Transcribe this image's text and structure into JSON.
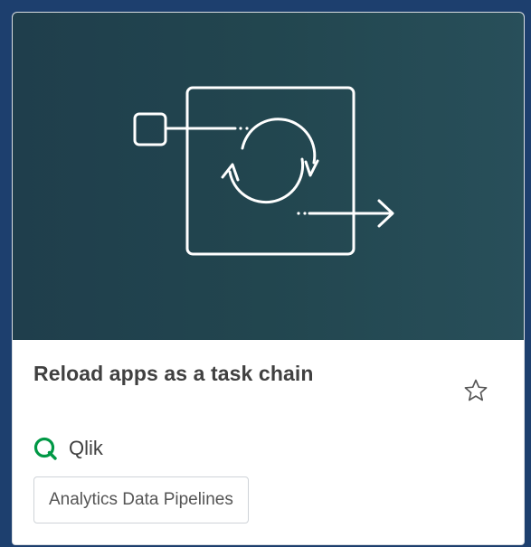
{
  "card": {
    "title": "Reload apps as a task chain",
    "provider": {
      "name": "Qlik",
      "logo_icon": "qlik-q-logo-icon",
      "logo_color": "#009845"
    },
    "tag": "Analytics Data Pipelines",
    "favorite_icon": "star-outline-icon",
    "hero_illustration": "task-chain-reload-icon"
  },
  "colors": {
    "page_background": "#1d3f6e",
    "hero_background": "#22464f",
    "title_text": "#404040",
    "tag_border": "#cfd3d8"
  }
}
